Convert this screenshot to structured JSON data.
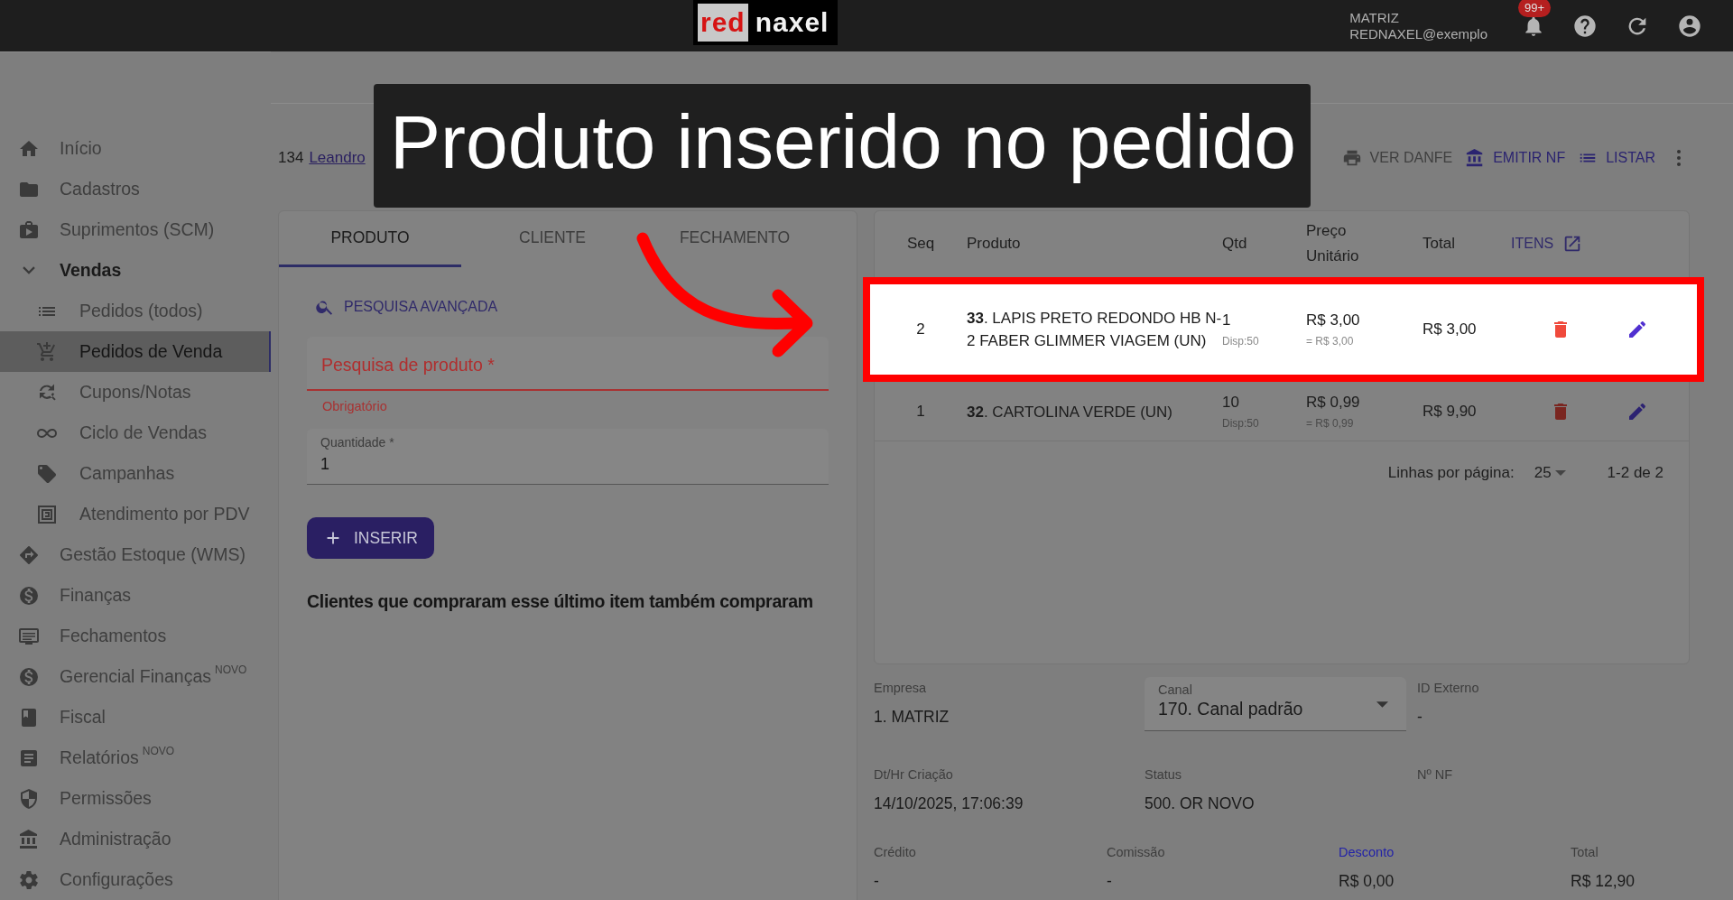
{
  "topbar": {
    "logo": {
      "part_1": "red",
      "part_2": "naxel"
    },
    "company": "MATRIZ",
    "user": "REDNAXEL@exemplo",
    "notifications_badge": "99+"
  },
  "sidebar": {
    "items": [
      {
        "label": "Início",
        "selected": false
      },
      {
        "label": "Cadastros",
        "selected": false
      },
      {
        "label": "Suprimentos (SCM)",
        "selected": false
      },
      {
        "label": "Vendas",
        "selected": false,
        "expanded": true,
        "children": [
          {
            "label": "Pedidos (todos)",
            "selected": false
          },
          {
            "label": "Pedidos de Venda",
            "selected": true
          },
          {
            "label": "Cupons/Notas",
            "selected": false
          },
          {
            "label": "Ciclo de Vendas",
            "selected": false
          },
          {
            "label": "Campanhas",
            "selected": false
          },
          {
            "label": "Atendimento por PDV",
            "selected": false
          }
        ]
      },
      {
        "label": "Gestão Estoque (WMS)",
        "selected": false
      },
      {
        "label": "Finanças",
        "selected": false
      },
      {
        "label": "Fechamentos",
        "selected": false
      },
      {
        "label": "Gerencial Finanças",
        "badge": "NOVO",
        "selected": false
      },
      {
        "label": "Fiscal",
        "selected": false
      },
      {
        "label": "Relatórios",
        "badge": "NOVO",
        "selected": false
      },
      {
        "label": "Permissões",
        "selected": false
      },
      {
        "label": "Administração",
        "selected": false
      },
      {
        "label": "Configurações",
        "selected": false
      }
    ]
  },
  "breadcrumb": {
    "number": "134",
    "link": "Leandro"
  },
  "actions": [
    {
      "label": "VER DANFE",
      "disabled": true
    },
    {
      "label": "EMITIR NF",
      "disabled": false
    },
    {
      "label": "LISTAR",
      "disabled": false
    }
  ],
  "caption": "Produto inserido no pedido",
  "tabs": [
    {
      "label": "PRODUTO",
      "selected": true
    },
    {
      "label": "CLIENTE",
      "selected": false
    },
    {
      "label": "FECHAMENTO",
      "selected": false
    }
  ],
  "product_form": {
    "advanced_search": "PESQUISA AVANÇADA",
    "search_field": {
      "placeholder": "Pesquisa de produto *",
      "error": "Obrigatório"
    },
    "quantity": {
      "label": "Quantidade *",
      "value": "1"
    },
    "insert_button": "INSERIR",
    "suggestions_heading": "Clientes que compraram esse último item também compraram"
  },
  "items_table": {
    "columns": [
      "Seq",
      "Produto",
      "Qtd",
      "Preço Unitário",
      "Total"
    ],
    "items_link": "ITENS",
    "rows": [
      {
        "seq": "2",
        "product": "**33**. LAPIS PRETO REDONDO HB N-2 FABER GLIMMER VIAGEM (UN)",
        "qty": "1",
        "available": "Disp:50",
        "price": "R$ 3,00",
        "price_note": "= R$ 3,00",
        "total": "R$ 3,00",
        "highlighted": true
      },
      {
        "seq": "1",
        "product": "**32**. CARTOLINA VERDE (UN)",
        "qty": "10",
        "available": "Disp:50",
        "price": "R$ 0,99",
        "price_note": "= R$ 0,99",
        "total": "R$ 9,90",
        "highlighted": false
      }
    ],
    "pagination": {
      "label": "Linhas por página:",
      "per_page": "25",
      "range": "1-2 de 2"
    }
  },
  "details": {
    "rows": [
      {
        "fields": [
          {
            "kind": "plain",
            "label": "Empresa",
            "value": "1. MATRIZ"
          },
          {
            "kind": "select",
            "label": "Canal",
            "value": "170. Canal padrão"
          },
          {
            "kind": "plain",
            "label": "ID Externo",
            "value": "-"
          }
        ]
      },
      {
        "fields": [
          {
            "kind": "plain",
            "label": "Dt/Hr Criação",
            "value": "14/10/2025, 17:06:39"
          },
          {
            "kind": "plain",
            "label": "Status",
            "value": "500. OR NOVO"
          },
          {
            "kind": "plain",
            "label": "Nº NF"
          }
        ]
      },
      {
        "fields": [
          {
            "kind": "plain",
            "label": "Crédito",
            "value": "-"
          },
          {
            "kind": "plain",
            "label": "Comissão",
            "value": "-"
          },
          {
            "kind": "link",
            "label": "Desconto",
            "value": "R$ 0,00"
          },
          {
            "kind": "plain",
            "label": "Total",
            "value": "R$ 12,90"
          }
        ]
      }
    ]
  }
}
